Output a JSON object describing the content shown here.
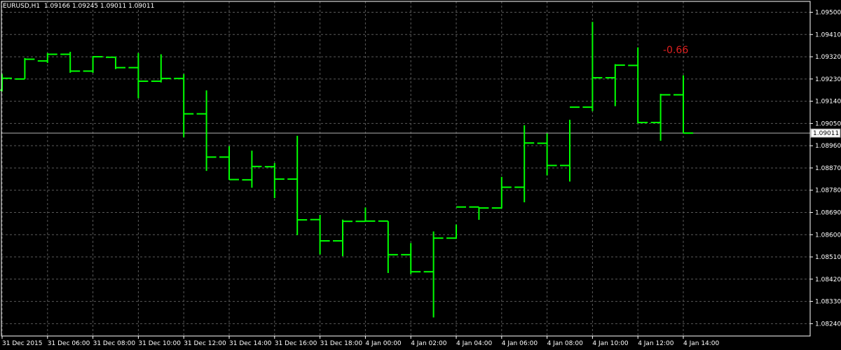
{
  "header": {
    "symbol": "EURUSD,H1",
    "ohlc": "1.09166 1.09245 1.09011 1.09011"
  },
  "annotation": "-0.66",
  "current_price_label": "1.09011",
  "colors": {
    "background": "#000000",
    "grid": "#5a5a5a",
    "bar": "#00ff00",
    "axis_text": "#ffffff",
    "price_line": "#b0b0b0",
    "annotation": "#e02020"
  },
  "chart_data": {
    "type": "ohlc",
    "title": "EURUSD,H1",
    "xlabel": "",
    "ylabel": "",
    "ylim": [
      1.0819,
      1.09544
    ],
    "grid": true,
    "y_ticks": [
      "1.09500",
      "1.09410",
      "1.09320",
      "1.09230",
      "1.09140",
      "1.09050",
      "1.08960",
      "1.08870",
      "1.08780",
      "1.08690",
      "1.08600",
      "1.08510",
      "1.08420",
      "1.08330",
      "1.08240"
    ],
    "x_ticks": [
      "31 Dec 2015",
      "31 Dec 06:00",
      "31 Dec 08:00",
      "31 Dec 10:00",
      "31 Dec 12:00",
      "31 Dec 14:00",
      "31 Dec 16:00",
      "31 Dec 18:00",
      "4 Jan 00:00",
      "4 Jan 02:00",
      "4 Jan 04:00",
      "4 Jan 06:00",
      "4 Jan 08:00",
      "4 Jan 10:00",
      "4 Jan 12:00",
      "4 Jan 14:00"
    ],
    "current_price": 1.09011,
    "bars": [
      {
        "o": 1.09185,
        "h": 1.0925,
        "l": 1.0918,
        "c": 1.09233
      },
      {
        "o": 1.0923,
        "h": 1.09315,
        "l": 1.0923,
        "c": 1.0931
      },
      {
        "o": 1.09303,
        "h": 1.09335,
        "l": 1.09295,
        "c": 1.0933
      },
      {
        "o": 1.0933,
        "h": 1.0934,
        "l": 1.09255,
        "c": 1.09262
      },
      {
        "o": 1.09262,
        "h": 1.09323,
        "l": 1.09255,
        "c": 1.0932
      },
      {
        "o": 1.09318,
        "h": 1.0932,
        "l": 1.0927,
        "c": 1.09276
      },
      {
        "o": 1.09276,
        "h": 1.09335,
        "l": 1.09152,
        "c": 1.09221
      },
      {
        "o": 1.09221,
        "h": 1.0933,
        "l": 1.09216,
        "c": 1.09232
      },
      {
        "o": 1.09232,
        "h": 1.0925,
        "l": 1.08994,
        "c": 1.09089
      },
      {
        "o": 1.09089,
        "h": 1.09184,
        "l": 1.08858,
        "c": 1.08914
      },
      {
        "o": 1.08914,
        "h": 1.08958,
        "l": 1.08822,
        "c": 1.08823
      },
      {
        "o": 1.08822,
        "h": 1.0894,
        "l": 1.0879,
        "c": 1.08876
      },
      {
        "o": 1.08875,
        "h": 1.0889,
        "l": 1.08748,
        "c": 1.08825
      },
      {
        "o": 1.08825,
        "h": 1.09,
        "l": 1.08598,
        "c": 1.0866
      },
      {
        "o": 1.08661,
        "h": 1.0868,
        "l": 1.0852,
        "c": 1.08575
      },
      {
        "o": 1.08575,
        "h": 1.08661,
        "l": 1.08513,
        "c": 1.08654
      },
      {
        "o": 1.08654,
        "h": 1.0871,
        "l": 1.08653,
        "c": 1.08655
      },
      {
        "o": 1.08655,
        "h": 1.08655,
        "l": 1.08445,
        "c": 1.08519
      },
      {
        "o": 1.08519,
        "h": 1.08566,
        "l": 1.0844,
        "c": 1.0845
      },
      {
        "o": 1.0845,
        "h": 1.08613,
        "l": 1.08265,
        "c": 1.08586
      },
      {
        "o": 1.08586,
        "h": 1.08641,
        "l": 1.08583,
        "c": 1.08712
      },
      {
        "o": 1.08712,
        "h": 1.08712,
        "l": 1.0866,
        "c": 1.08708
      },
      {
        "o": 1.08708,
        "h": 1.08834,
        "l": 1.08707,
        "c": 1.08792
      },
      {
        "o": 1.08792,
        "h": 1.09043,
        "l": 1.08731,
        "c": 1.08971
      },
      {
        "o": 1.0897,
        "h": 1.0901,
        "l": 1.0884,
        "c": 1.0888
      },
      {
        "o": 1.0888,
        "h": 1.09065,
        "l": 1.08815,
        "c": 1.09116
      },
      {
        "o": 1.09116,
        "h": 1.09461,
        "l": 1.091,
        "c": 1.09235
      },
      {
        "o": 1.09235,
        "h": 1.0929,
        "l": 1.0912,
        "c": 1.09286
      },
      {
        "o": 1.09285,
        "h": 1.09358,
        "l": 1.0905,
        "c": 1.09054
      },
      {
        "o": 1.09054,
        "h": 1.0917,
        "l": 1.0898,
        "c": 1.09166
      },
      {
        "o": 1.09166,
        "h": 1.09245,
        "l": 1.09011,
        "c": 1.09011
      }
    ]
  }
}
